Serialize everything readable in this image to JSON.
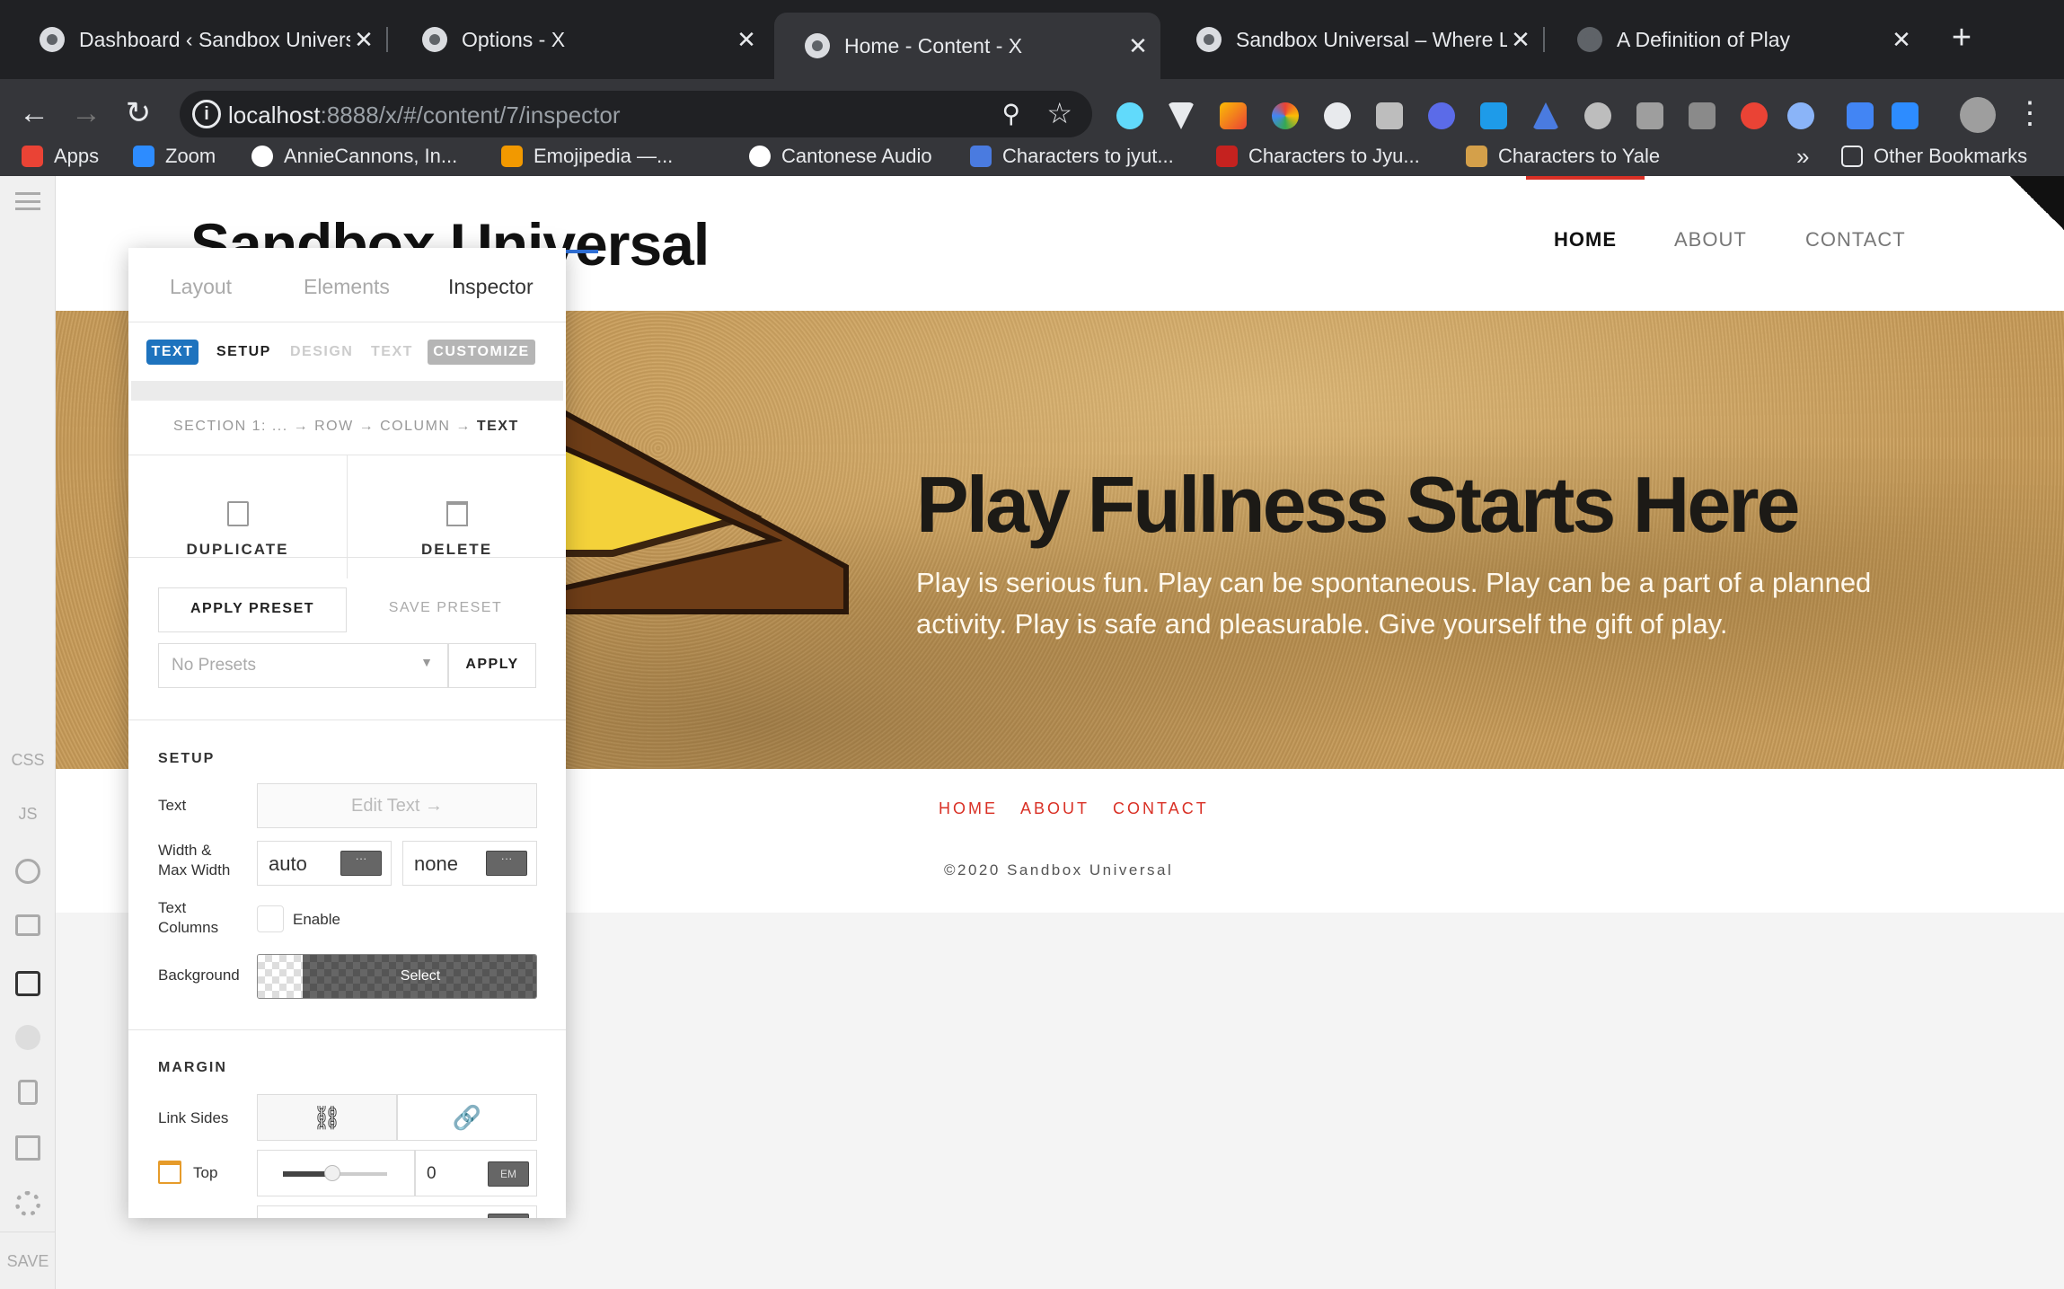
{
  "browser": {
    "tabs": [
      {
        "title": "Dashboard ‹ Sandbox Universal",
        "active": false
      },
      {
        "title": "Options - X",
        "active": false
      },
      {
        "title": "Home - Content - X",
        "active": true
      },
      {
        "title": "Sandbox Universal – Where Life",
        "active": false
      },
      {
        "title": "A Definition of Play",
        "active": false
      }
    ],
    "new_tab": "+",
    "close": "✕",
    "url_host": "localhost",
    "url_rest": ":8888/x/#/content/7/inspector",
    "bookmarks": [
      {
        "label": "Apps",
        "color": "#ea4335"
      },
      {
        "label": "Zoom",
        "color": "#2d8cff"
      },
      {
        "label": "AnnieCannons, In...",
        "color": "#ffffff"
      },
      {
        "label": "Emojipedia —...",
        "color": "#f29900"
      },
      {
        "label": "Cantonese Audio",
        "color": "#ffffff"
      },
      {
        "label": "Characters to jyut...",
        "color": "#4a7be0"
      },
      {
        "label": "Characters to Jyu...",
        "color": "#c5221f"
      },
      {
        "label": "Characters to Yale",
        "color": "#d4a04a"
      }
    ],
    "more_bookmarks": "»",
    "other_bookmarks": "Other Bookmarks"
  },
  "rail": {
    "css": "CSS",
    "js": "JS",
    "save": "SAVE"
  },
  "site": {
    "logo": "Sandbox Universal",
    "nav": [
      "HOME",
      "ABOUT",
      "CONTACT"
    ],
    "hero_title": "Play Fullness Starts Here",
    "hero_subtitle": "Play is serious fun. Play can be spontaneous. Play can be a part of a planned activity. Play is safe and pleasurable. Give yourself the gift of play.",
    "footer_links": [
      "HOME",
      "ABOUT",
      "CONTACT"
    ],
    "copyright": "©2020 Sandbox Universal"
  },
  "panel": {
    "tabs": [
      "Layout",
      "Elements",
      "Inspector"
    ],
    "pills": {
      "text": "TEXT",
      "setup": "SETUP",
      "design": "DESIGN",
      "text2": "TEXT",
      "customize": "CUSTOMIZE"
    },
    "breadcrumb": {
      "section": "SECTION 1: ...",
      "row": "ROW",
      "column": "COLUMN",
      "current": "TEXT",
      "arrow": "→"
    },
    "duplicate": "DUPLICATE",
    "delete": "DELETE",
    "apply_preset": "APPLY PRESET",
    "save_preset": "SAVE PRESET",
    "preset_placeholder": "No Presets",
    "apply": "APPLY",
    "setup": {
      "title": "SETUP",
      "text_label": "Text",
      "edit_text": "Edit Text →",
      "width_label_1": "Width &",
      "width_label_2": "Max Width",
      "width_value": "auto",
      "max_width_value": "none",
      "columns_label_1": "Text",
      "columns_label_2": "Columns",
      "enable": "Enable",
      "background_label": "Background",
      "select": "Select"
    },
    "margin": {
      "title": "MARGIN",
      "link_sides": "Link Sides",
      "top_label": "Top",
      "top_value": "0",
      "unit": "EM"
    }
  }
}
